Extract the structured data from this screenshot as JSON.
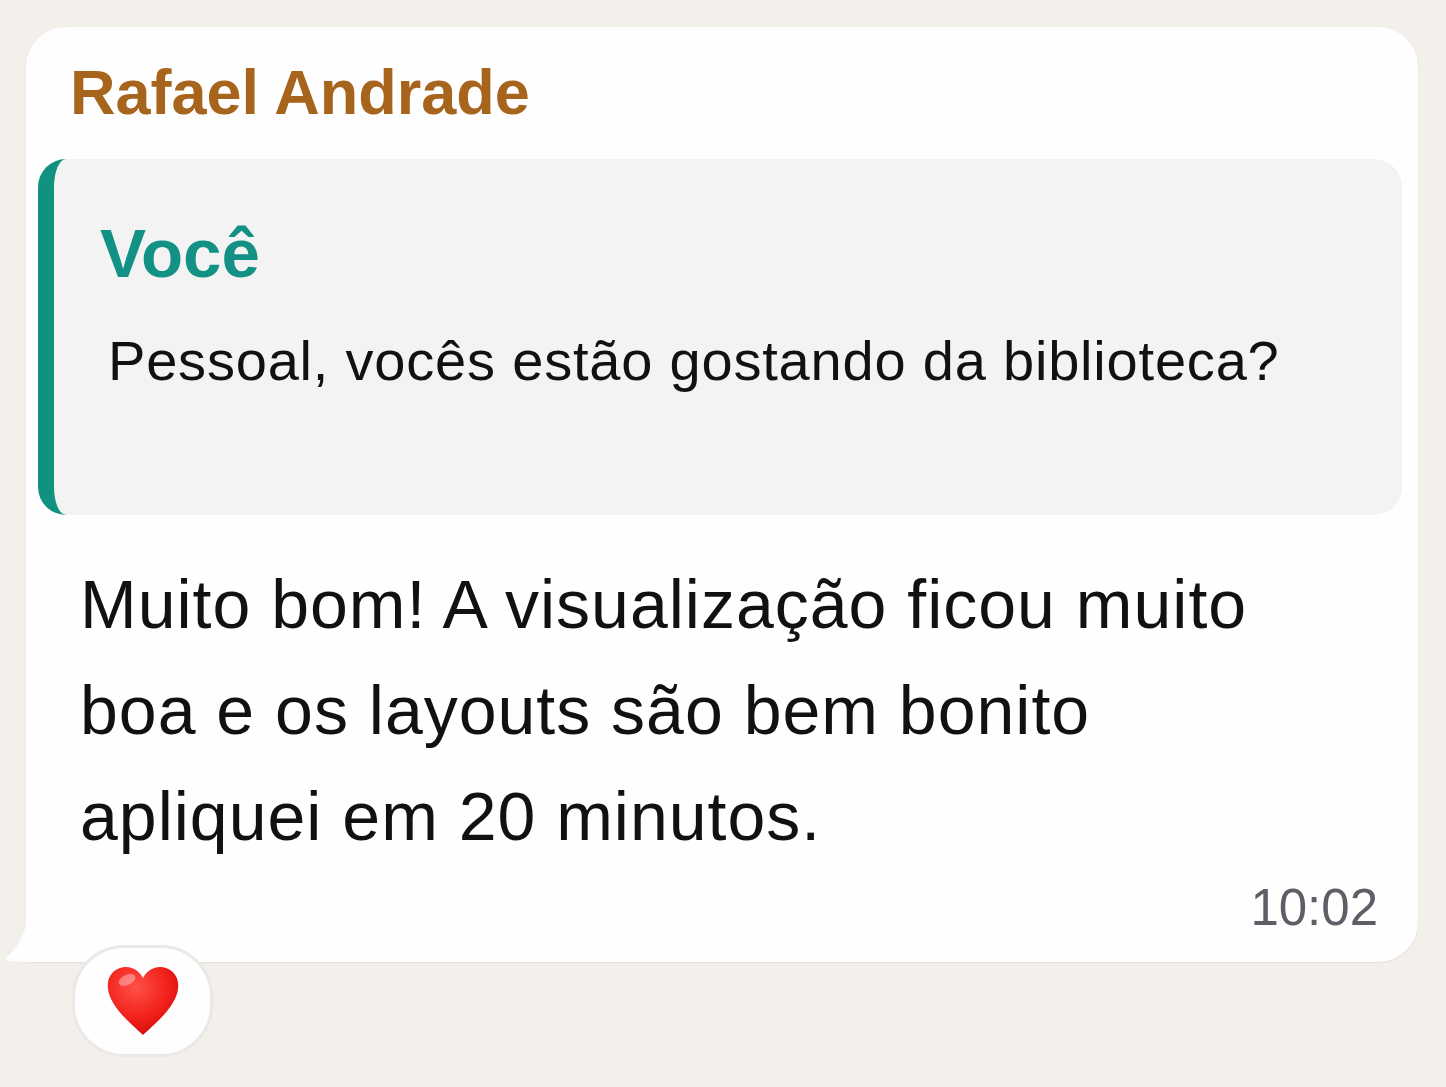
{
  "message": {
    "sender": "Rafael Andrade",
    "reply_to": {
      "author": "Você",
      "text": "Pessoal, vocês estão gostando da biblioteca?"
    },
    "text": "Muito bom! A visualização ficou muito boa e os layouts são bem bonito apliquei em 20 minutos.",
    "time": "10:02",
    "reactions": [
      {
        "kind": "heart"
      }
    ]
  }
}
